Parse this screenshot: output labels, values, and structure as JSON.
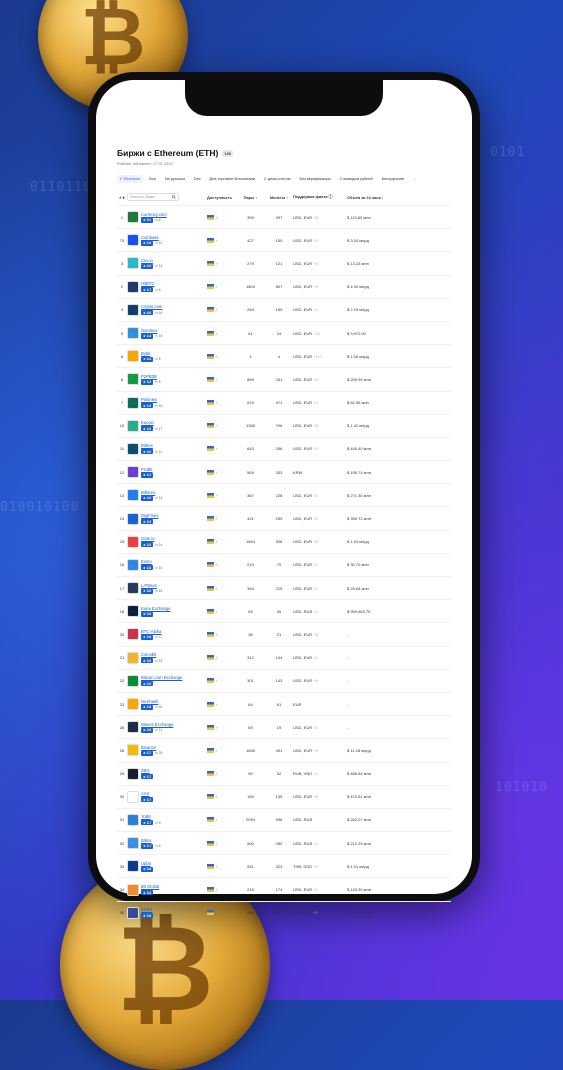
{
  "page": {
    "title": "Биржи с Ethereum (ETH)",
    "count": "166",
    "updated": "Рейтинг обновлен: 17.01.2022"
  },
  "tabs": [
    {
      "label": "С Ethereum",
      "active": true
    },
    {
      "label": "Все"
    },
    {
      "label": "На русском"
    },
    {
      "label": "Dex"
    },
    {
      "label": "Для торговли биткоинами"
    },
    {
      "label": "С демо-счетом"
    },
    {
      "label": "Без верификации"
    },
    {
      "label": "С выводом рублей"
    },
    {
      "label": "Белорусские"
    },
    {
      "label": "..."
    }
  ],
  "table_header": {
    "rank": "# ▾",
    "search_placeholder": "Поиск по бирже",
    "availability": "Доступность",
    "pairs": "Пары ↕",
    "coins": "Монеты ↕",
    "fiat": "Поддержка фиата ⓘ",
    "volume": "Объем за 24 часа ↕"
  },
  "colors": {
    "accent": "#1560d8",
    "check": "#27a14b"
  },
  "rows": [
    {
      "rank": "1",
      "name": "Currency.com",
      "rating": "5.0",
      "reviews": "6",
      "logo_color": "#1e7a3a",
      "pairs": "359",
      "coins": "297",
      "fiat": "USD, EUR",
      "fiat_more": "+5",
      "volume": "$ 113.63 млн"
    },
    {
      "rank": "73",
      "name": "Coinbase",
      "rating": "2.6",
      "reviews": "12",
      "logo_color": "#1652f0",
      "pairs": "427",
      "coins": "150",
      "fiat": "USD, EUR",
      "fiat_more": "+2",
      "volume": "$ 3.04 млрд"
    },
    {
      "rank": "3",
      "name": "Cex.io",
      "rating": "4.9",
      "reviews": "14",
      "logo_color": "#2bb8c8",
      "pairs": "279",
      "coins": "121",
      "fiat": "USD, EUR",
      "fiat_more": "+3",
      "volume": "$ 13.23 млн"
    },
    {
      "rank": "2",
      "name": "HitBTC",
      "rating": "4.7",
      "reviews": "6",
      "logo_color": "#1e3a6e",
      "pairs": "1804",
      "coins": "807",
      "fiat": "USD, EUR",
      "fiat_more": "+9",
      "volume": "$ 4.00 млрд"
    },
    {
      "rank": "4",
      "name": "Crypto.com",
      "rating": "4.6",
      "reviews": "16",
      "logo_color": "#103f68",
      "pairs": "264",
      "coins": "159",
      "fiat": "USD, EUR",
      "fiat_more": "+1",
      "volume": "$ 2.15 млрд"
    },
    {
      "rank": "5",
      "name": "Nominex",
      "rating": "4.4",
      "reviews": "15",
      "logo_color": "#2d8fe0",
      "pairs": "61",
      "coins": "24",
      "fiat": "USD, EUR",
      "fiat_more": "+12",
      "volume": "$ 9,970.00"
    },
    {
      "rank": "6",
      "name": "Bybit",
      "rating": "4.4",
      "reviews": "5",
      "logo_color": "#f7a600",
      "pairs": "4",
      "coins": "4",
      "fiat": "USD, EUR",
      "fiat_more": "+117",
      "volume": "$ 1.00 млрд"
    },
    {
      "rank": "8",
      "name": "P2PB2B",
      "rating": "4.3",
      "reviews": "5",
      "logo_color": "#159a43",
      "pairs": "869",
      "coins": "251",
      "fiat": "USD, EUR",
      "fiat_more": "+9",
      "volume": "$ 205.94 млн"
    },
    {
      "rank": "7",
      "name": "Poloniex",
      "rating": "4.3",
      "reviews": "16",
      "logo_color": "#0c6b5d",
      "pairs": "675",
      "coins": "471",
      "fiat": "USD, EUR",
      "fiat_more": "+3",
      "volume": "$ 52.55 млн"
    },
    {
      "rank": "10",
      "name": "Kucoin",
      "rating": "4.0",
      "reviews": "17",
      "logo_color": "#24ae8f",
      "pairs": "1365",
      "coins": "706",
      "fiat": "USD, EUR",
      "fiat_more": "+5",
      "volume": "$ 1.42 млрд"
    },
    {
      "rank": "11",
      "name": "Bittrex",
      "rating": "4.0",
      "reviews": "11",
      "logo_color": "#0b4f6c",
      "pairs": "643",
      "coins": "256",
      "fiat": "USD, EUR",
      "fiat_more": "+2",
      "volume": "$ 445.40 млн"
    },
    {
      "rank": "12",
      "name": "ProBit",
      "rating": "4.1",
      "reviews": "",
      "logo_color": "#6a3fd1",
      "pairs": "569",
      "coins": "333",
      "fiat": "KRW",
      "fiat_more": "",
      "volume": "$ 156.74 млн"
    },
    {
      "rank": "13",
      "name": "Bitforex",
      "rating": "4.0",
      "reviews": "14",
      "logo_color": "#1e7ef2",
      "pairs": "367",
      "coins": "228",
      "fiat": "USD, EUR",
      "fiat_more": "+1",
      "volume": "$ 271.30 млн"
    },
    {
      "rank": "14",
      "name": "DigiFinex",
      "rating": "3.9",
      "reviews": "",
      "logo_color": "#1b5fd9",
      "pairs": "421",
      "coins": "259",
      "fiat": "USD, EUR",
      "fiat_more": "+2",
      "volume": "$ 390.72 млн"
    },
    {
      "rank": "15",
      "name": "Gate.io",
      "rating": "3.9",
      "reviews": "14",
      "logo_color": "#e84142",
      "pairs": "1664",
      "coins": "928",
      "fiat": "USD, EUR",
      "fiat_more": "+8",
      "volume": "$ 1.03 млрд"
    },
    {
      "rank": "16",
      "name": "Exmo",
      "rating": "3.8",
      "reviews": "10",
      "logo_color": "#2f86e6",
      "pairs": "243",
      "coins": "70",
      "fiat": "USD, EUR",
      "fiat_more": "+1",
      "volume": "$ 30.70 млн"
    },
    {
      "rank": "17",
      "name": "LAToken",
      "rating": "3.8",
      "reviews": "15",
      "logo_color": "#243a5e",
      "pairs": "364",
      "coins": "215",
      "fiat": "USD, EUR",
      "fiat_more": "+1",
      "volume": "$ 29.64 млн"
    },
    {
      "rank": "18",
      "name": "Kuna Exchange",
      "rating": "3.8",
      "reviews": "",
      "logo_color": "#0d1f3c",
      "pairs": "65",
      "coins": "39",
      "fiat": "USD, RUB",
      "fiat_more": "+1",
      "volume": "$ 959,563.75"
    },
    {
      "rank": "20",
      "name": "BTC-Alpha",
      "rating": "3.8",
      "reviews": "11",
      "logo_color": "#c7334a",
      "pairs": "36",
      "coins": "21",
      "fiat": "USD, EUR",
      "fiat_more": "+8",
      "volume": "-"
    },
    {
      "rank": "21",
      "name": "Coinsbit",
      "rating": "3.8",
      "reviews": "15",
      "logo_color": "#f3b52b",
      "pairs": "312",
      "coins": "104",
      "fiat": "USD, EUR",
      "fiat_more": "+1",
      "volume": "-"
    },
    {
      "rank": "22",
      "name": "Bitcoin.com Exchange",
      "rating": "3.8",
      "reviews": "",
      "logo_color": "#0c8a3a",
      "pairs": "301",
      "coins": "143",
      "fiat": "USD, EUR",
      "fiat_more": "+6",
      "volume": "-"
    },
    {
      "rank": "23",
      "name": "Nicehash",
      "rating": "3.8",
      "reviews": "16",
      "logo_color": "#f7a900",
      "pairs": "84",
      "coins": "61",
      "fiat": "EUR",
      "fiat_more": "",
      "volume": "-"
    },
    {
      "rank": "28",
      "name": "Waves Exchange",
      "rating": "3.8",
      "reviews": "12",
      "logo_color": "#1b2a4a",
      "pairs": "69",
      "coins": "19",
      "fiat": "USD, EUR",
      "fiat_more": "+1",
      "volume": "-"
    },
    {
      "rank": "26",
      "name": "Binance",
      "rating": "3.7",
      "reviews": "25",
      "logo_color": "#f0b90b",
      "pairs": "1685",
      "coins": "491",
      "fiat": "USD, EUR",
      "fiat_more": "+9",
      "volume": "$ 11.28 млрд"
    },
    {
      "rank": "29",
      "name": "ZBG",
      "rating": "3.7",
      "reviews": "",
      "logo_color": "#1b1b2e",
      "pairs": "90",
      "coins": "52",
      "fiat": "RUB, VND",
      "fiat_more": "+1",
      "volume": "$ 466.54 млн"
    },
    {
      "rank": "30",
      "name": "AAX",
      "rating": "3.7",
      "reviews": "",
      "logo_color": "#ffffff",
      "pairs": "150",
      "coins": "135",
      "fiat": "USD, EUR",
      "fiat_more": "+8",
      "volume": "$ 470.61 млн"
    },
    {
      "rank": "31",
      "name": "YoBit",
      "rating": "3.7",
      "reviews": "9",
      "logo_color": "#2c7fd6",
      "pairs": "2094",
      "coins": "996",
      "fiat": "USD, RUB",
      "fiat_more": "",
      "volume": "$ 262.07 млн"
    },
    {
      "rank": "32",
      "name": "Bibox",
      "rating": "3.7",
      "reviews": "5",
      "logo_color": "#3b8fe6",
      "pairs": "500",
      "coins": "280",
      "fiat": "USD, RUB",
      "fiat_more": "+1",
      "volume": "$ 212.29 млн"
    },
    {
      "rank": "33",
      "name": "Upbit",
      "rating": "3.6",
      "reviews": "",
      "logo_color": "#0d3c8f",
      "pairs": "551",
      "coins": "323",
      "fiat": "THB, SGD",
      "fiat_more": "+2",
      "volume": "$ 1.01 млрд"
    },
    {
      "rank": "34",
      "name": "Bit Global",
      "rating": "3.6",
      "reviews": "",
      "logo_color": "#f08a2b",
      "pairs": "215",
      "coins": "174",
      "fiat": "USD, EUR",
      "fiat_more": "+1",
      "volume": "$ 143.30 млн"
    },
    {
      "rank": "35",
      "name": "BKEX",
      "rating": "3.6",
      "reviews": "",
      "logo_color": "#3a4a9a",
      "pairs": "454",
      "coins": "387",
      "fiat": "USD, EUR",
      "fiat_more": "+1",
      "volume": "$ 764.33 млн"
    }
  ]
}
